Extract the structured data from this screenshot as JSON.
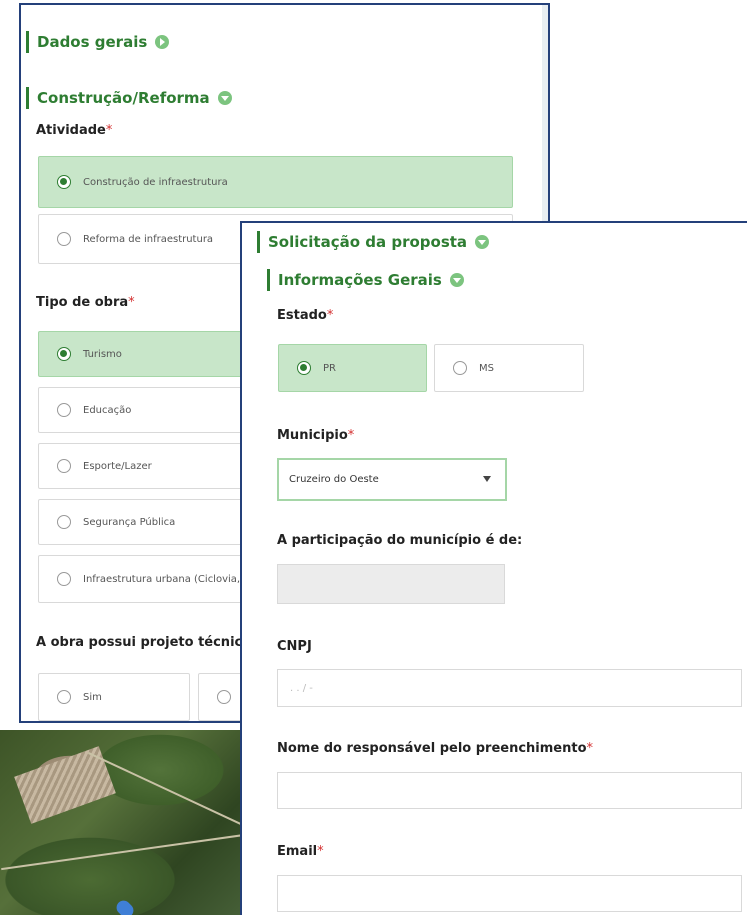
{
  "form1": {
    "dados_gerais": "Dados gerais",
    "construcao": "Construção/Reforma",
    "atividade": {
      "label": "Atividade",
      "required": "*",
      "options": [
        "Construção de infraestrutura",
        "Reforma de infraestrutura"
      ],
      "selected": 0
    },
    "tipo_obra": {
      "label": "Tipo de obra",
      "required": "*",
      "options": [
        "Turismo",
        "Educação",
        "Esporte/Lazer",
        "Segurança Pública",
        "Infraestrutura urbana (Ciclovia,"
      ],
      "selected": 0
    },
    "projeto_tecnico": {
      "label": "A obra possui projeto técnico c",
      "options": [
        "Sim"
      ]
    }
  },
  "form2": {
    "solicitacao": "Solicitação da proposta",
    "informacoes_gerais": "Informações Gerais",
    "estado": {
      "label": "Estado",
      "required": "*",
      "options": [
        "PR",
        "MS"
      ],
      "selected": 0
    },
    "municipio": {
      "label": "Municipio",
      "required": "*",
      "value": "Cruzeiro do Oeste"
    },
    "participacao": {
      "label": "A participação do município é de:",
      "value": ""
    },
    "cnpj": {
      "label": "CNPJ",
      "placeholder": ". . /  -"
    },
    "responsavel": {
      "label": "Nome do responsável pelo preenchimento",
      "required": "*",
      "value": ""
    },
    "email": {
      "label": "Email",
      "required": "*",
      "value": ""
    }
  },
  "colors": {
    "accent_green": "#2e7d32",
    "selected_bg": "#c8e6c9",
    "panel_border": "#24407a"
  }
}
